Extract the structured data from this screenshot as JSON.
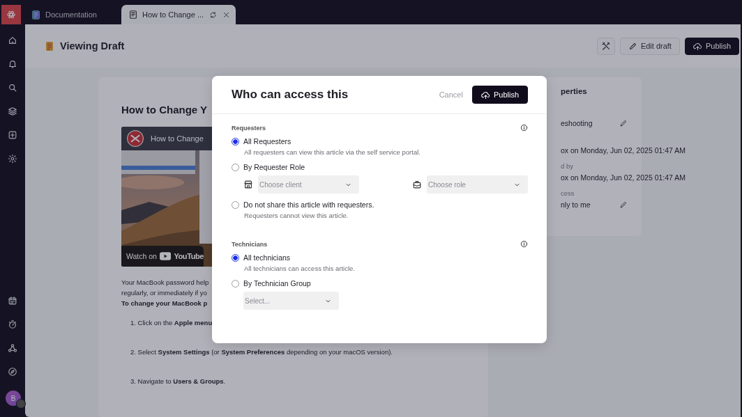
{
  "tabs": [
    {
      "label": "Documentation",
      "kind": "docs",
      "selected": false
    },
    {
      "label": "How to Change ...",
      "kind": "article",
      "selected": true
    }
  ],
  "sidebar": {
    "avatar": "B"
  },
  "header": {
    "title": "Viewing Draft",
    "buttons": [
      {
        "label": "Edit draft",
        "kind": "edit"
      },
      {
        "label": "Publish",
        "kind": "publish"
      }
    ]
  },
  "article": {
    "title": "How to Change Y",
    "video": {
      "title": "How to Change",
      "watch_on": "Watch on",
      "platform": "YouTube"
    },
    "lines": [
      {
        "text": "Your MacBook password help",
        "kind": "para"
      },
      {
        "text": "regularly, or immediately if yo",
        "kind": "para"
      },
      {
        "text": "To change your MacBook p",
        "kind": "heading"
      },
      {
        "text": "1. Click on the **Apple menu**",
        "kind": "step"
      },
      {
        "text": "2. Select **System Settings** (or **System Preferences** depending on your macOS version).",
        "kind": "step"
      },
      {
        "text": "3. Navigate to **Users & Groups**.",
        "kind": "step"
      }
    ]
  },
  "properties": {
    "title": "perties",
    "fields": [
      {
        "value": "eshooting",
        "editable": true
      },
      {
        "value": "ox on Monday, Jun 02, 2025 01:47 AM",
        "editable": false
      },
      {
        "label": "d by",
        "value": "ox on Monday, Jun 02, 2025 01:47 AM",
        "editable": false
      },
      {
        "label": "cess",
        "value": "nly to me",
        "editable": true
      }
    ]
  },
  "modal": {
    "title": "Who can access this",
    "cancel": "Cancel",
    "confirm": "Publish",
    "sections": [
      {
        "label": "Requesters",
        "options": [
          {
            "label": "All Requesters",
            "description": "All requesters can view this article via the self service portal.",
            "selected": true
          },
          {
            "label": "By Requester Role",
            "selected": false,
            "selects": [
              {
                "placeholder": "Choose client",
                "kind": "client"
              },
              {
                "placeholder": "Choose role",
                "kind": "role"
              }
            ]
          },
          {
            "label": "Do not share this article with requesters.",
            "description": "Requesters cannot view this article.",
            "selected": false
          }
        ]
      },
      {
        "label": "Technicians",
        "options": [
          {
            "label": "All technicians",
            "description": "All technicians can access this article.",
            "selected": true
          },
          {
            "label": "By Technician Group",
            "selected": false,
            "selects": [
              {
                "placeholder": "Select...",
                "kind": "group"
              }
            ]
          }
        ]
      }
    ]
  }
}
